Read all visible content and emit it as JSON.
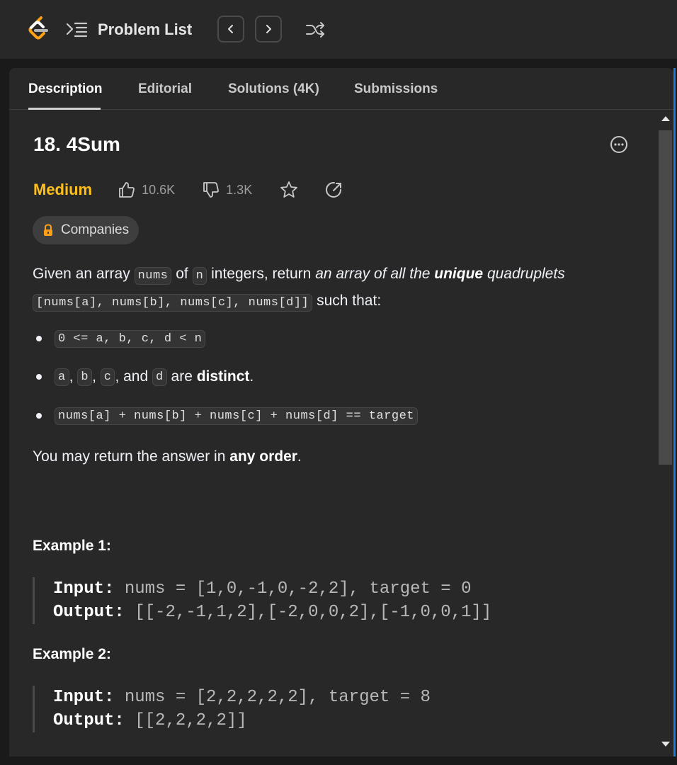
{
  "topbar": {
    "problem_list_label": "Problem List"
  },
  "tabs": [
    {
      "label": "Description"
    },
    {
      "label": "Editorial"
    },
    {
      "label": "Solutions (4K)"
    },
    {
      "label": "Submissions"
    }
  ],
  "problem": {
    "title": "18. 4Sum",
    "difficulty": "Medium",
    "likes": "10.6K",
    "dislikes": "1.3K",
    "companies_label": "Companies"
  },
  "description": {
    "p1_a": "Given an array ",
    "p1_code1": "nums",
    "p1_b": " of ",
    "p1_code2": "n",
    "p1_c": " integers, return ",
    "p1_em1": "an array of all the ",
    "p1_strong": "unique",
    "p1_em2": " quadruplets",
    "p1_code3": "[nums[a], nums[b], nums[c], nums[d]]",
    "p1_d": " such that:",
    "bullet1_code": "0 <= a, b, c, d < n",
    "bullet2_a": "a",
    "bullet2_b": "b",
    "bullet2_c": "c",
    "bullet2_d": "d",
    "bullet2_sep1": ", ",
    "bullet2_sep2": ", ",
    "bullet2_and": ", and ",
    "bullet2_are": " are ",
    "bullet2_strong": "distinct",
    "bullet2_end": ".",
    "bullet3_code": "nums[a] + nums[b] + nums[c] + nums[d] == target",
    "p2_a": "You may return the answer in ",
    "p2_strong": "any order",
    "p2_end": "."
  },
  "examples": [
    {
      "heading": "Example 1:",
      "input_label": "Input:",
      "input_value": " nums = [1,0,-1,0,-2,2], target = 0",
      "output_label": "Output:",
      "output_value": " [[-2,-1,1,2],[-2,0,0,2],[-1,0,0,1]]"
    },
    {
      "heading": "Example 2:",
      "input_label": "Input:",
      "input_value": " nums = [2,2,2,2,2], target = 8",
      "output_label": "Output:",
      "output_value": " [[2,2,2,2]]"
    }
  ],
  "colors": {
    "difficulty_medium": "#ffc01e",
    "accent_edge": "#1e78d8",
    "lock": "#ffa116"
  }
}
